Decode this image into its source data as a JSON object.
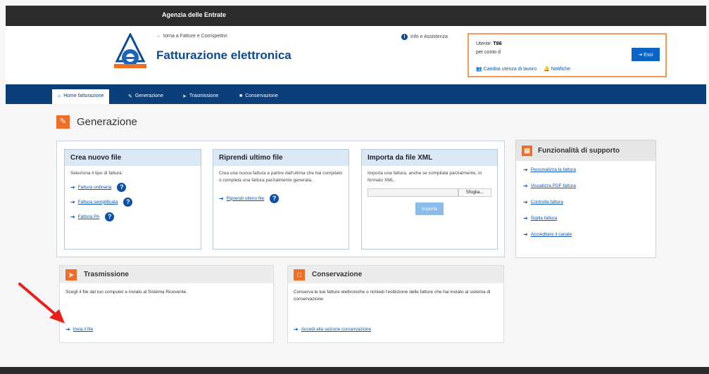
{
  "topbar": {
    "title": "Agenzia delle Entrate"
  },
  "header": {
    "back_link": "torna a Fatture e Corrispettivi",
    "app_title": "Fatturazione elettronica",
    "info_link": "Info e Assistenza",
    "user_label": "Utente:",
    "user_value": "T86",
    "behalf": "per conto d",
    "change_user": "Cambia utenza di lavoro",
    "notifications": "Notifiche",
    "exit": "Esci"
  },
  "nav": {
    "tabs": [
      {
        "label": "Home fatturazione",
        "icon": "home-icon",
        "active": true
      },
      {
        "label": "Generazione",
        "icon": "pencil-icon"
      },
      {
        "label": "Trasmissione",
        "icon": "send-icon"
      },
      {
        "label": "Conservazione",
        "icon": "archive-icon"
      }
    ]
  },
  "section": {
    "title": "Generazione"
  },
  "cards": [
    {
      "title": "Crea nuovo file",
      "text": "Seleziona il tipo di fattura:",
      "links": [
        "Fattura ordinaria",
        "Fattura semplificata",
        "Fattura PA"
      ]
    },
    {
      "title": "Riprendi ultimo file",
      "text": "Crea una nuova fattura a partire dall'ultima che hai compilato o completa una fattura parzialmente generata.",
      "link": "Riprendi ultimo file"
    },
    {
      "title": "Importa da file XML",
      "text": "Importa una fattura, anche se compilata parzialmente, in formato XML.",
      "browse": "Sfoglia...",
      "import": "Importa"
    }
  ],
  "support": {
    "title": "Funzionalità di supporto",
    "links": [
      "Personalizza la fattura",
      "Visualizza PDF fattura",
      "Controlla fattura",
      "Sigilla fattura",
      "Accreditare il canale"
    ]
  },
  "trasmissione": {
    "title": "Trasmissione",
    "text": "Scegli il file dal tuo computer e invialo al Sistema Ricevente.",
    "link": "Invia il file"
  },
  "conservazione": {
    "title": "Conservazione",
    "text": "Conserva le tue fatture elettroniche o richiedi l'esibizione delle fatture che hai inviato al sistema di conservazione.",
    "link": "Accedi alla sezione conservazione"
  },
  "colors": {
    "accent": "#ee6f27",
    "nav": "#0b3f7a",
    "link": "#0a56b8"
  }
}
